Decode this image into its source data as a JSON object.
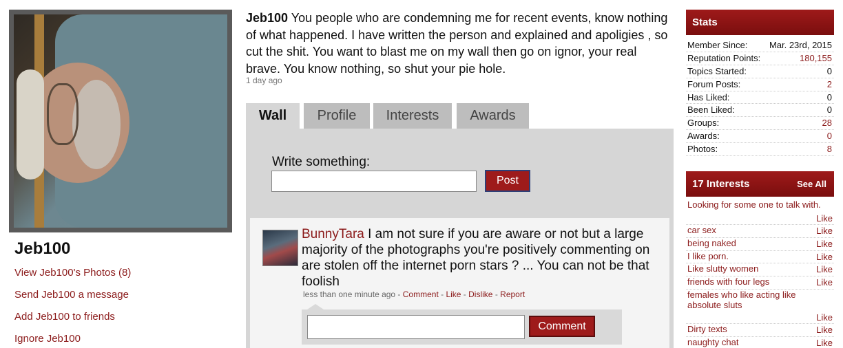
{
  "profile": {
    "username": "Jeb100",
    "links": [
      "View Jeb100's Photos (8)",
      "Send Jeb100 a message",
      "Add Jeb100 to friends",
      "Ignore Jeb100"
    ]
  },
  "status": {
    "author": "Jeb100",
    "text": " You people who are condemning me for recent events, know nothing of what happened. I have written the person and explained and apoligies , so cut the shit. You want to blast me on my wall then go on ignor, your real brave. You know nothing, so shut your pie hole.",
    "time": "1 day ago"
  },
  "tabs": [
    "Wall",
    "Profile",
    "Interests",
    "Awards"
  ],
  "wall": {
    "write_label": "Write something:",
    "post_label": "Post",
    "comment": {
      "author": "BunnyTara",
      "text": " I am not sure if you are aware or not but a large majority of the photographs you're positively commenting on are stolen off the internet porn stars ? ... You can not be that foolish",
      "time": "less than one minute ago",
      "sep": " - ",
      "actions": [
        "Comment",
        "Like",
        "Dislike",
        "Report"
      ]
    },
    "comment_button": "Comment"
  },
  "stats": {
    "header": "Stats",
    "rows": [
      {
        "label": "Member Since:",
        "value": "Mar. 23rd, 2015"
      },
      {
        "label": "Reputation Points:",
        "value": "180,155"
      },
      {
        "label": "Topics Started:",
        "value": "0"
      },
      {
        "label": "Forum Posts:",
        "value": "2"
      },
      {
        "label": "Has Liked:",
        "value": "0"
      },
      {
        "label": "Been Liked:",
        "value": "0"
      },
      {
        "label": "Groups:",
        "value": "28"
      },
      {
        "label": "Awards:",
        "value": "0"
      },
      {
        "label": "Photos:",
        "value": "8"
      }
    ]
  },
  "interests": {
    "header": "17 Interests",
    "see_all": "See All",
    "like_label": "Like",
    "items": [
      "Looking for some one to talk with.",
      "car sex",
      "being naked",
      "I like porn.",
      "Like slutty women",
      "friends with four legs",
      "females who like acting like absolute sluts",
      "Dirty texts",
      "naughty chat"
    ]
  },
  "colors": {
    "accent": "#8b1a1a",
    "header_red": "#9e1a1a",
    "tab_bg": "#bdbdbd",
    "panel_bg": "#d6d6d6"
  }
}
